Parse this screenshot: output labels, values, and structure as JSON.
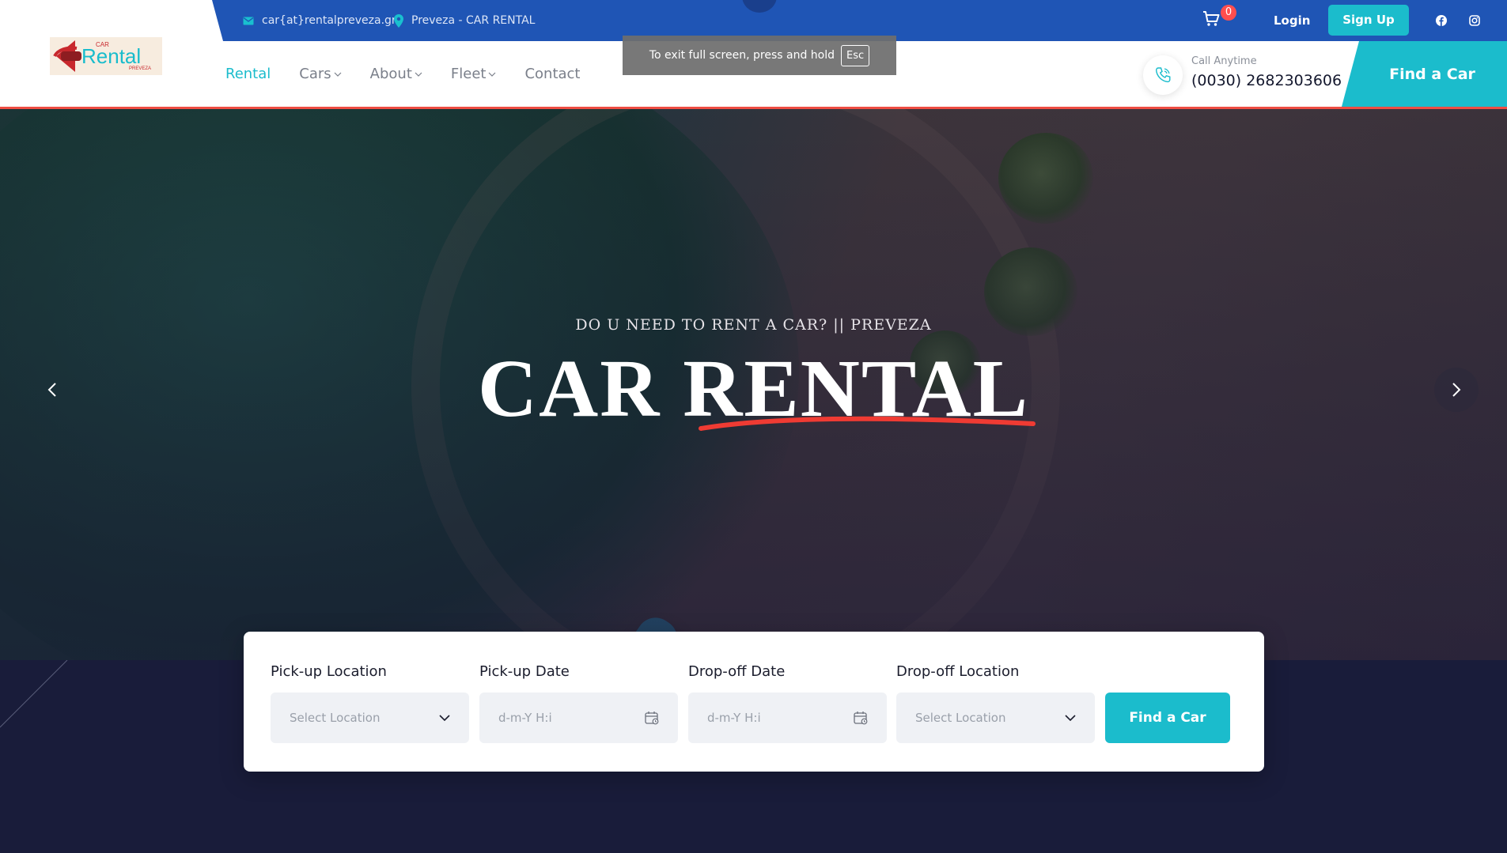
{
  "topbar": {
    "email": "car{at}rentalpreveza.gr",
    "location": "Preveza - CAR RENTAL",
    "cart_count": "0",
    "login_label": "Login",
    "signup_label": "Sign Up"
  },
  "nav": {
    "items": [
      {
        "label": "Rental",
        "active": true,
        "has_dropdown": false
      },
      {
        "label": "Cars",
        "active": false,
        "has_dropdown": true
      },
      {
        "label": "About",
        "active": false,
        "has_dropdown": true
      },
      {
        "label": "Fleet",
        "active": false,
        "has_dropdown": true
      },
      {
        "label": "Contact",
        "active": false,
        "has_dropdown": false
      }
    ]
  },
  "call": {
    "label": "Call Anytime",
    "phone": "(0030) 2682303606"
  },
  "header_cta": "Find a Car",
  "fullscreen_toast": {
    "text": "To exit full screen, press and hold",
    "key": "Esc"
  },
  "hero": {
    "subtitle": "DO U NEED TO RENT A CAR? || PREVEZA",
    "title": "CAR RENTAL"
  },
  "booking": {
    "pickup_location": {
      "label": "Pick-up Location",
      "placeholder": "Select Location"
    },
    "pickup_date": {
      "label": "Pick-up Date",
      "placeholder": "d-m-Y H:i"
    },
    "dropoff_date": {
      "label": "Drop-off Date",
      "placeholder": "d-m-Y H:i"
    },
    "dropoff_location": {
      "label": "Drop-off Location",
      "placeholder": "Select Location"
    },
    "submit": "Find a Car"
  },
  "colors": {
    "topbar": "#1f55b5",
    "accent": "#1bbccc",
    "red_accent": "#ef4d43",
    "dark_bg": "#191c3a"
  }
}
